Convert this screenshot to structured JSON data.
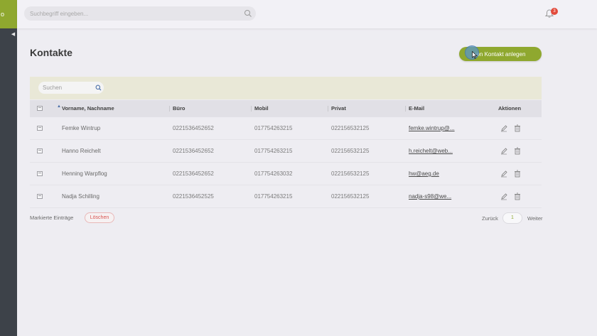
{
  "app": {
    "logo_text": "o"
  },
  "search": {
    "placeholder": "Suchbegriff eingeben..."
  },
  "notifications": {
    "count": "3"
  },
  "page": {
    "title": "Kontakte",
    "new_contact_label": "uen Kontakt anlegen"
  },
  "table": {
    "search_placeholder": "Suchen",
    "columns": [
      "Vorname, Nachname",
      "Büro",
      "Mobil",
      "Privat",
      "E-Mail",
      "Aktionen"
    ],
    "rows": [
      {
        "name": "Femke Wintrup",
        "buero": "0221536452652",
        "mobil": "017754263215",
        "privat": "022156532125",
        "email": "femke.wintrup@..."
      },
      {
        "name": "Hanno Reichelt",
        "buero": "0221536452652",
        "mobil": "017754263215",
        "privat": "022156532125",
        "email": "h.reichelt@web..."
      },
      {
        "name": "Henning Warpflog",
        "buero": "0221536452652",
        "mobil": "017754263032",
        "privat": "022156532125",
        "email": "hw@aeg.de"
      },
      {
        "name": "Nadja Schilling",
        "buero": "0221536452525",
        "mobil": "017754263215",
        "privat": "022156532125",
        "email": "nadja-s98@we..."
      }
    ]
  },
  "footer": {
    "marked_label": "Markierte Einträge",
    "delete_label": "Löschen",
    "prev_label": "Zurück",
    "page": "1",
    "next_label": "Weiter"
  },
  "colors": {
    "accent": "#8fa82f",
    "danger": "#d9534f",
    "sidebar": "#3d4249"
  },
  "icons": [
    "search-icon",
    "bell-icon",
    "pencil-icon",
    "trash-icon",
    "checkbox-icon",
    "sort-ascending-icon",
    "collapse-arrow-icon",
    "mouse-cursor-icon"
  ]
}
